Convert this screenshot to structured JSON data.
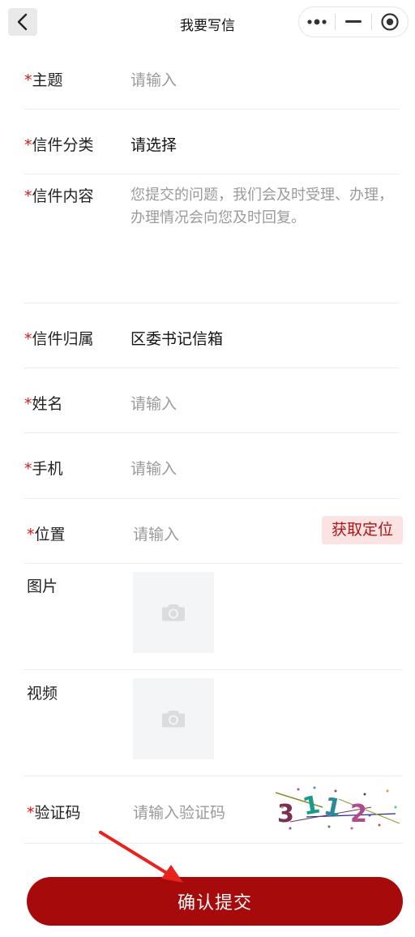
{
  "header": {
    "title": "我要写信",
    "back_icon": "chevron-left-icon",
    "more_icon": "more-dots-icon",
    "minimize_icon": "minimize-icon",
    "close_icon": "target-circle-icon"
  },
  "form": {
    "required_mark": "*",
    "subject": {
      "label": "主题",
      "placeholder": "请输入"
    },
    "category": {
      "label": "信件分类",
      "value": "请选择"
    },
    "content": {
      "label": "信件内容",
      "placeholder": "您提交的问题，我们会及时受理、办理，办理情况会向您及时回复。"
    },
    "belong": {
      "label": "信件归属",
      "value": "区委书记信箱"
    },
    "name": {
      "label": "姓名",
      "placeholder": "请输入"
    },
    "phone": {
      "label": "手机",
      "placeholder": "请输入"
    },
    "location": {
      "label": "位置",
      "placeholder": "请输入",
      "button": "获取定位"
    },
    "image": {
      "label": "图片",
      "icon": "camera-icon"
    },
    "video": {
      "label": "视频",
      "icon": "camera-icon"
    },
    "captcha": {
      "label": "验证码",
      "placeholder": "请输入验证码",
      "code_text": "3112"
    }
  },
  "submit": {
    "label": "确认提交"
  },
  "colors": {
    "accent": "#a60a0a",
    "required": "#d21a1a",
    "locate_bg": "#fbe3e3",
    "arrow": "#e8231e"
  }
}
